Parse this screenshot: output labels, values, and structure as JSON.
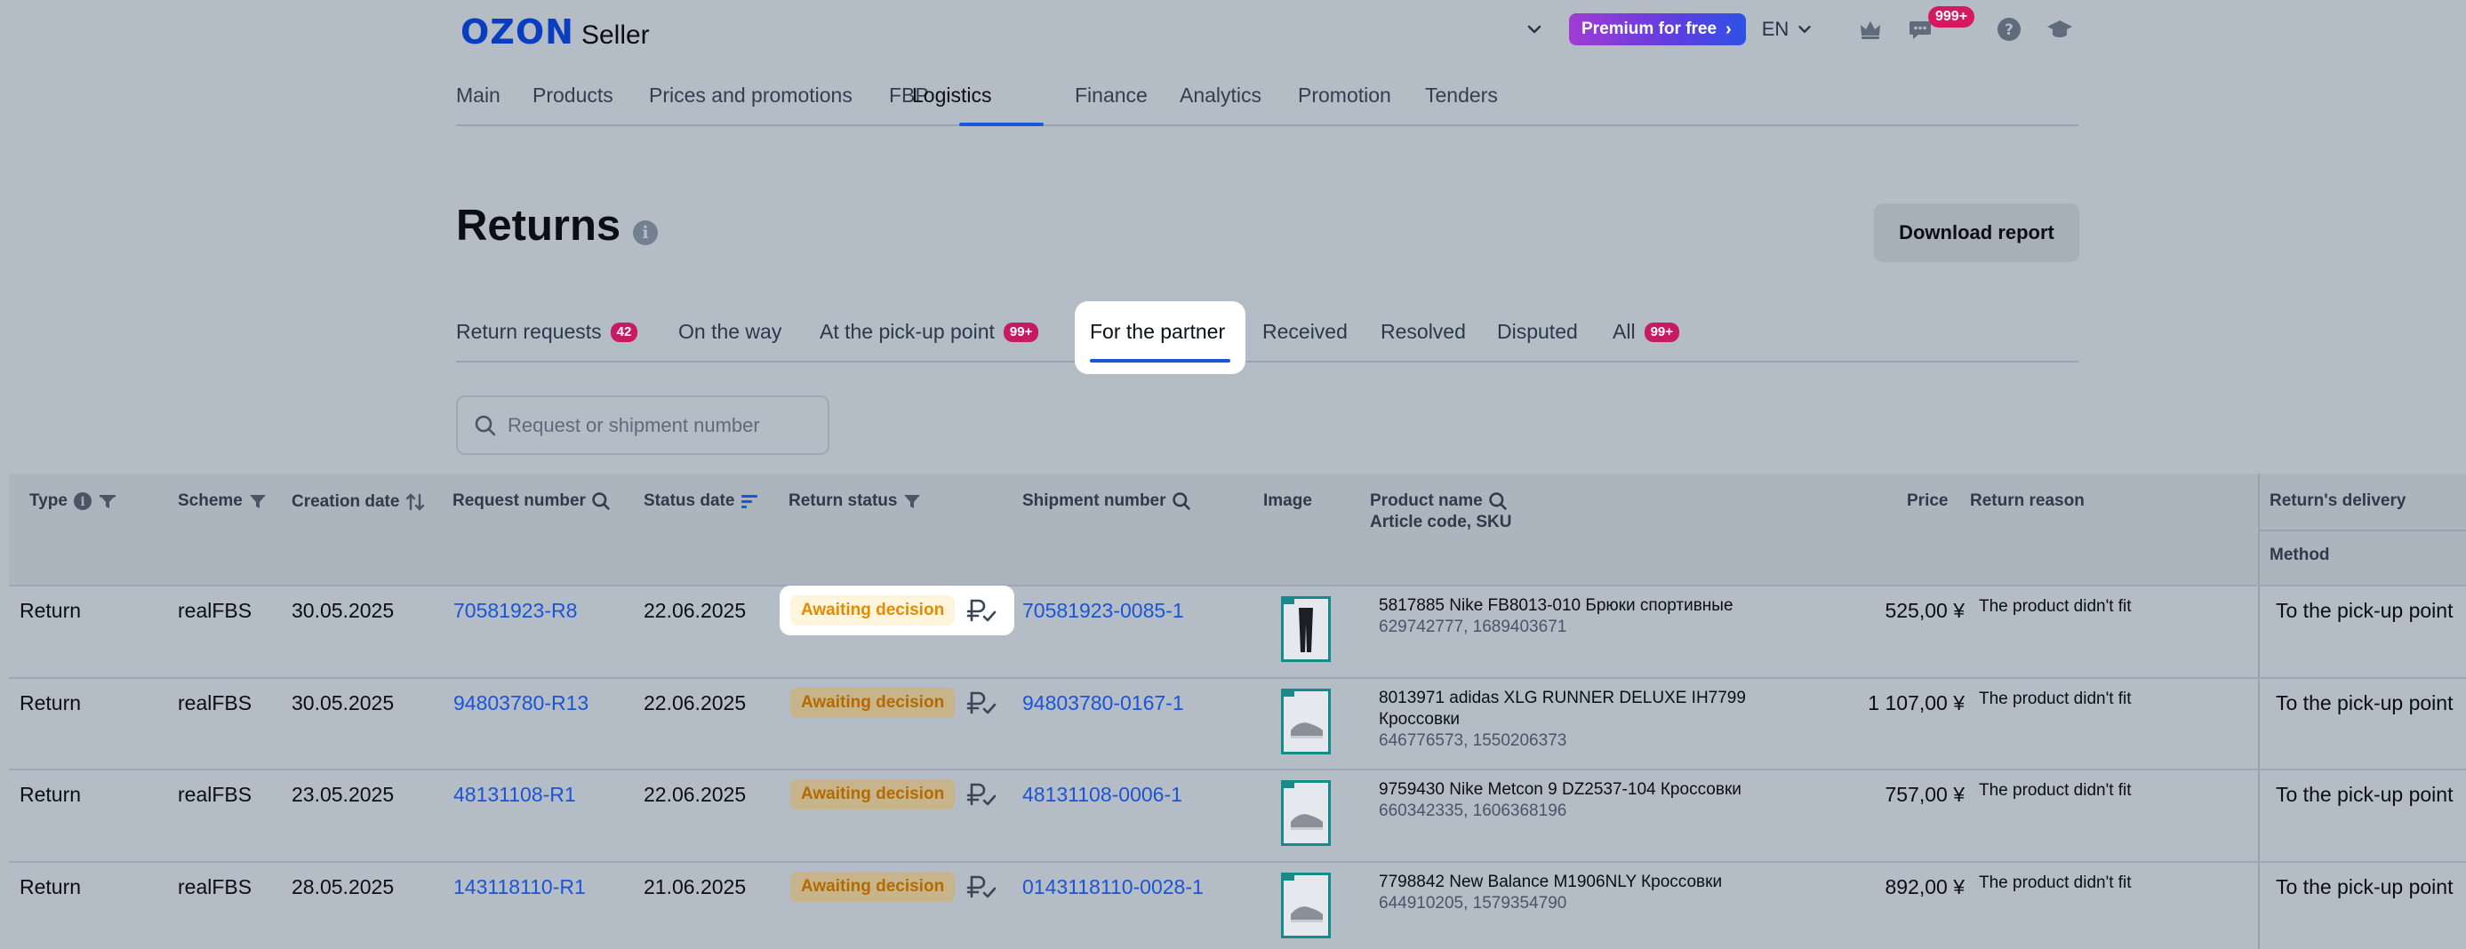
{
  "header": {
    "logo_brand": "OZON",
    "logo_product": "Seller",
    "premium_label": "Premium for free",
    "language": "EN",
    "notifications_count": "999+"
  },
  "nav": {
    "items": [
      "Main",
      "Products",
      "Prices and promotions",
      "FBP",
      "Logistics",
      "Finance",
      "Analytics",
      "Promotion",
      "Tenders"
    ],
    "active": "Logistics"
  },
  "page": {
    "title": "Returns",
    "download_label": "Download report"
  },
  "tabs": [
    {
      "label": "Return requests",
      "count": "42"
    },
    {
      "label": "On the way",
      "count": ""
    },
    {
      "label": "At the pick-up point",
      "count": "99+"
    },
    {
      "label": "For the partner",
      "count": ""
    },
    {
      "label": "Received",
      "count": ""
    },
    {
      "label": "Resolved",
      "count": ""
    },
    {
      "label": "Disputed",
      "count": ""
    },
    {
      "label": "All",
      "count": "99+"
    }
  ],
  "active_tab": "For the partner",
  "search": {
    "placeholder": "Request or shipment number"
  },
  "table": {
    "columns": {
      "type": "Type",
      "scheme": "Scheme",
      "creation_date": "Creation date",
      "request_number": "Request number",
      "status_date": "Status date",
      "return_status": "Return status",
      "shipment_number": "Shipment number",
      "image": "Image",
      "product_name": "Product name",
      "article_sku": "Article code, SKU",
      "price": "Price",
      "return_reason": "Return reason",
      "returns_delivery": "Return's delivery",
      "method": "Method"
    },
    "rows": [
      {
        "type": "Return",
        "scheme": "realFBS",
        "creation_date": "30.05.2025",
        "request_number": "70581923-R8",
        "status_date": "22.06.2025",
        "status": "Awaiting decision",
        "shipment_number": "70581923-0085-1",
        "product_name": "5817885 Nike FB8013-010 Брюки спортивные",
        "product_name_2": "",
        "codes": "629742777, 1689403671",
        "price": "525,00 ¥",
        "reason": "The product didn't fit",
        "method": "To the pick-up point"
      },
      {
        "type": "Return",
        "scheme": "realFBS",
        "creation_date": "30.05.2025",
        "request_number": "94803780-R13",
        "status_date": "22.06.2025",
        "status": "Awaiting decision",
        "shipment_number": "94803780-0167-1",
        "product_name": "8013971 adidas XLG RUNNER DELUXE IH7799",
        "product_name_2": "Кроссовки",
        "codes": "646776573, 1550206373",
        "price": "1 107,00 ¥",
        "reason": "The product didn't fit",
        "method": "To the pick-up point"
      },
      {
        "type": "Return",
        "scheme": "realFBS",
        "creation_date": "23.05.2025",
        "request_number": "48131108-R1",
        "status_date": "22.06.2025",
        "status": "Awaiting decision",
        "shipment_number": "48131108-0006-1",
        "product_name": "9759430 Nike Metcon 9 DZ2537-104 Кроссовки",
        "product_name_2": "",
        "codes": "660342335, 1606368196",
        "price": "757,00 ¥",
        "reason": "The product didn't fit",
        "method": "To the pick-up point"
      },
      {
        "type": "Return",
        "scheme": "realFBS",
        "creation_date": "28.05.2025",
        "request_number": "143118110-R1",
        "status_date": "21.06.2025",
        "status": "Awaiting decision",
        "shipment_number": "0143118110-0028-1",
        "product_name": "7798842 New Balance M1906NLY Кроссовки",
        "product_name_2": "",
        "codes": "644910205, 1579354790",
        "price": "892,00 ¥",
        "reason": "The product didn't fit",
        "method": "To the pick-up point"
      }
    ]
  },
  "colors": {
    "accent": "#1757d8",
    "badge": "#c81a63",
    "status_text": "#e58b00"
  }
}
